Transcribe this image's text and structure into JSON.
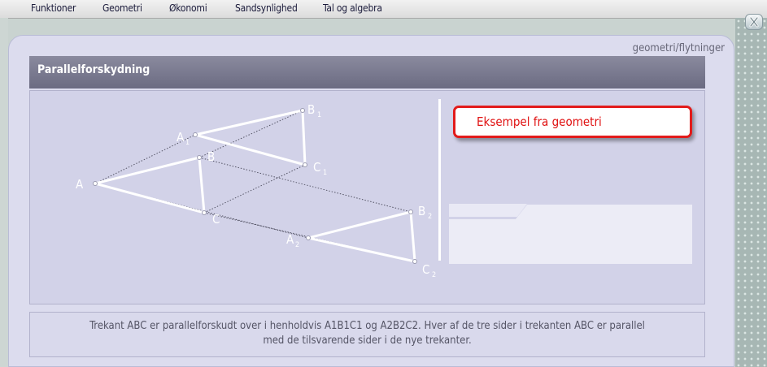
{
  "menu": {
    "items": [
      {
        "label": "Funktioner"
      },
      {
        "label": "Geometri"
      },
      {
        "label": "Økonomi"
      },
      {
        "label": "Sandsynlighed"
      },
      {
        "label": "Tal og algebra"
      }
    ]
  },
  "breadcrumb": "geometri/flytninger",
  "header": {
    "title": "Parallelforskydning"
  },
  "example_button": {
    "label": "Eksempel fra geometri"
  },
  "figure": {
    "points": {
      "A": "A",
      "B": "B",
      "C": "C",
      "A1": "A",
      "A1_sub": "1",
      "B1": "B",
      "B1_sub": "1",
      "C1": "C",
      "C1_sub": "1",
      "A2": "A",
      "A2_sub": "2",
      "B2": "B",
      "B2_sub": "2",
      "C2": "C",
      "C2_sub": "2"
    }
  },
  "caption": {
    "line1": "Trekant ABC er parallelforskudt over i henholdvis A1B1C1 og A2B2C2. Hver af de tre sider i trekanten ABC er parallel",
    "line2": "med de tilsvarende sider i de nye trekanter."
  },
  "colors": {
    "accent_red": "#e21b1b",
    "title_bar": "#74748a",
    "panel": "#dcdcee"
  }
}
